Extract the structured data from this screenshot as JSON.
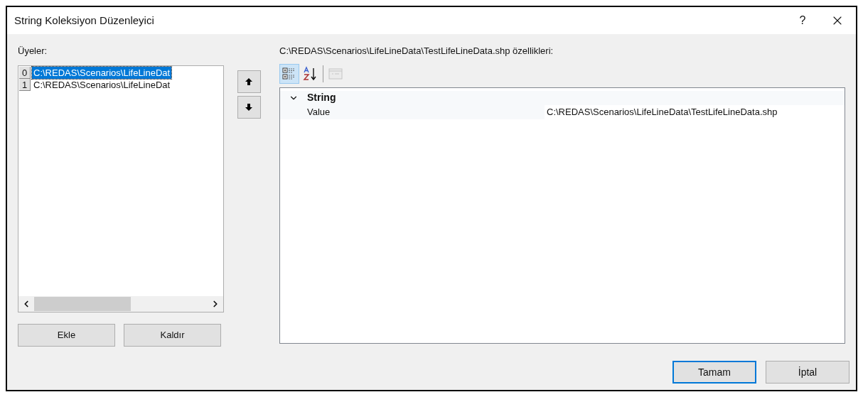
{
  "window": {
    "title": "String Koleksiyon Düzenleyici",
    "help": "?"
  },
  "members": {
    "label": "Üyeler:",
    "items": [
      {
        "index": "0",
        "text": "C:\\REDAS\\Scenarios\\LifeLineDat",
        "selected": true
      },
      {
        "index": "1",
        "text": "C:\\REDAS\\Scenarios\\LifeLineDat",
        "selected": false
      }
    ]
  },
  "member_buttons": [
    "Ekle",
    "Kaldır"
  ],
  "properties": {
    "label": "C:\\REDAS\\Scenarios\\LifeLineData\\TestLifeLineData.shp özellikleri:",
    "toolbar": [
      {
        "kind": "categorized",
        "selected": true,
        "disabled": false
      },
      {
        "kind": "alphabetical",
        "selected": false,
        "disabled": false
      },
      {
        "kind": "pages",
        "selected": false,
        "disabled": true
      }
    ],
    "categories": [
      {
        "name": "String",
        "expanded": true,
        "rows": [
          {
            "name": "Value",
            "value": "C:\\REDAS\\Scenarios\\LifeLineData\\TestLifeLineData.shp"
          }
        ]
      }
    ]
  },
  "dialog_buttons": [
    {
      "label": "Tamam",
      "default": true
    },
    {
      "label": "İptal",
      "default": false
    }
  ]
}
